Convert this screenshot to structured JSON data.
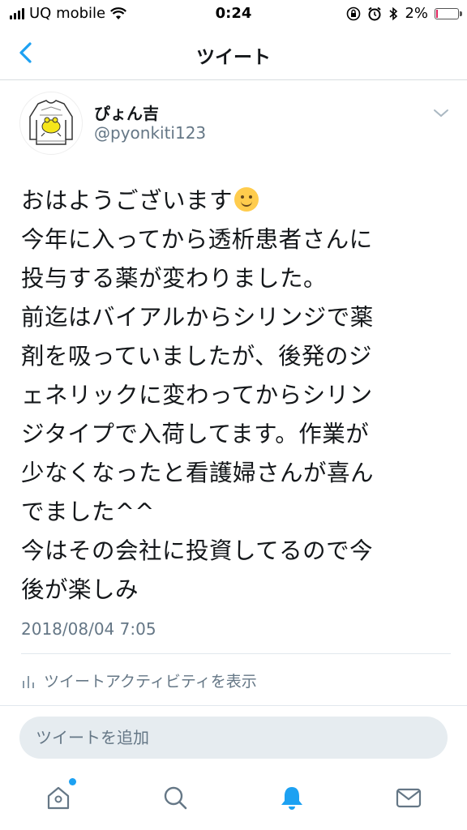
{
  "status_bar": {
    "carrier": "UQ mobile",
    "time": "0:24",
    "battery": "2%",
    "battery_level": 0.02
  },
  "nav": {
    "title": "ツイート",
    "back_icon": "chevron-left-icon"
  },
  "tweet": {
    "author_name": "ぴょん吉",
    "author_handle": "@pyonkiti123",
    "text_line1": "おはようございます",
    "text_body": "今年に入ってから透析患者さんに\n投与する薬が変わりました。\n前迄はバイアルからシリンジで薬\n剤を吸っていましたが、後発のジ\nェネリックに変わってからシリン\nジタイプで入荷してます。作業が\n少なくなったと看護婦さんが喜ん\nでました^^\n今はその会社に投資してるので今\n後が楽しみ",
    "timestamp": "2018/08/04 7:05",
    "activity_label": "ツイートアクティビティを表示"
  },
  "reply": {
    "placeholder": "ツイートを追加"
  },
  "tabs": [
    {
      "icon": "home-icon",
      "has_badge": true
    },
    {
      "icon": "search-icon"
    },
    {
      "icon": "bell-icon",
      "active": true
    },
    {
      "icon": "mail-icon"
    }
  ],
  "colors": {
    "accent": "#1da1f2",
    "secondary_text": "#657786",
    "battery_low": "#e0245e"
  }
}
